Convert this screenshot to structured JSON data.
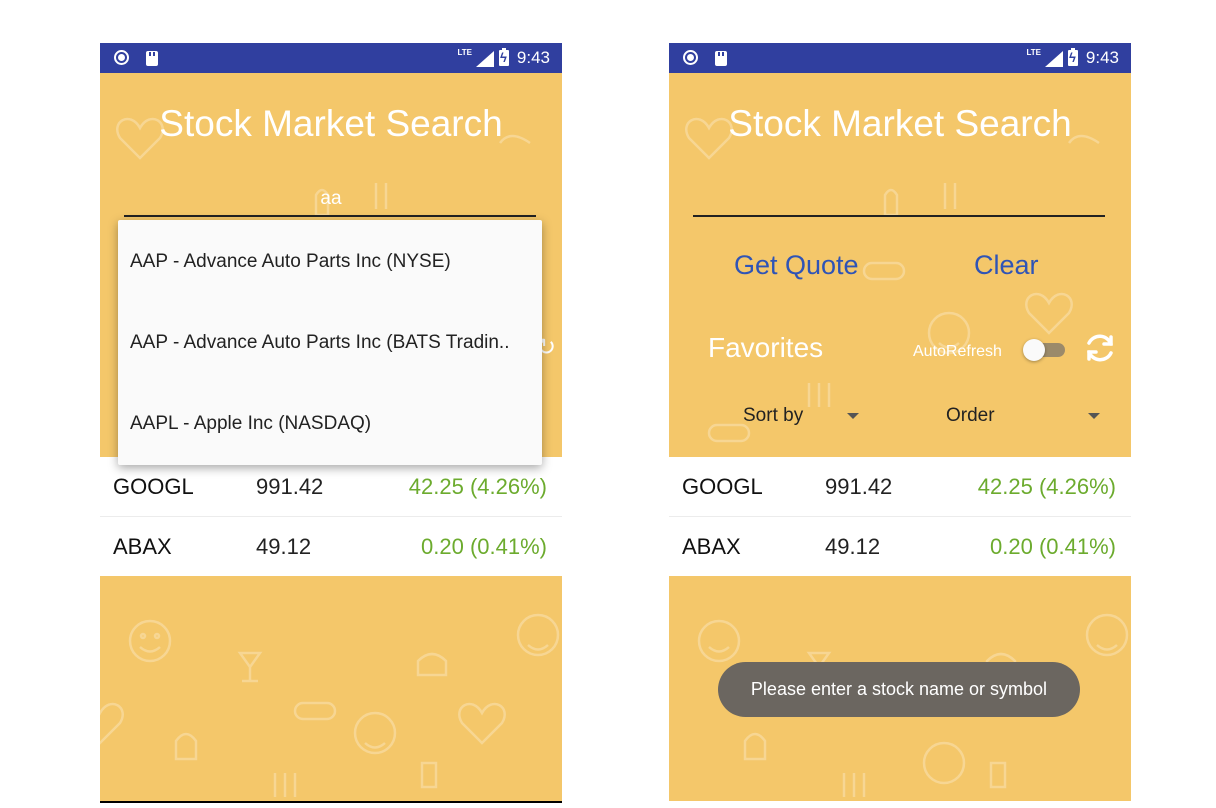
{
  "colors": {
    "status_bar": "#303F9F",
    "app_background": "#F4C76A",
    "accent_text": "#2F54B6",
    "positive_change": "#6CAB2E",
    "toast_background": "#6b6660"
  },
  "status_bar": {
    "network": "LTE",
    "time": "9:43",
    "icons": [
      "record-icon",
      "sd-card-icon",
      "signal-icon",
      "battery-charging-icon"
    ]
  },
  "app": {
    "title": "Stock Market Search"
  },
  "left_screen": {
    "search": {
      "value": "aa"
    },
    "autocomplete": [
      "AAP - Advance Auto Parts Inc (NYSE)",
      "AAP - Advance Auto Parts Inc (BATS Tradin..",
      "AAPL - Apple Inc (NASDAQ)"
    ]
  },
  "right_screen": {
    "search": {
      "value": ""
    },
    "buttons": {
      "get_quote": "Get Quote",
      "clear": "Clear"
    },
    "favorites_label": "Favorites",
    "autorefresh_label": "AutoRefresh",
    "autorefresh_on": false,
    "sort_by": "Sort by",
    "order": "Order",
    "toast": "Please enter a stock name or symbol"
  },
  "favorites": [
    {
      "symbol": "GOOGL",
      "price": "991.42",
      "change": "42.25 (4.26%)"
    },
    {
      "symbol": "ABAX",
      "price": "49.12",
      "change": "0.20 (0.41%)"
    }
  ]
}
